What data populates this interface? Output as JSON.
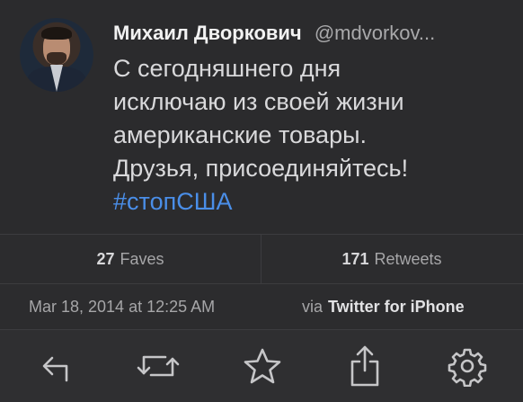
{
  "tweet": {
    "author_name": "Михаил Дворкович",
    "author_handle": "@mdvorkov...",
    "text_lines": [
      "С сегодняшнего дня",
      "исключаю из своей жизни",
      "американские товары.",
      "Друзья, присоединяйтесь!"
    ],
    "hashtag": "#стопСША"
  },
  "stats": {
    "faves_count": "27",
    "faves_label": "Faves",
    "retweets_count": "171",
    "retweets_label": "Retweets"
  },
  "meta": {
    "timestamp": "Mar 18, 2014 at 12:25 AM",
    "via_label": "via",
    "client": "Twitter for iPhone"
  },
  "toolbar": {
    "icons": [
      "reply-icon",
      "retweet-icon",
      "favorite-icon",
      "share-icon",
      "settings-icon"
    ]
  },
  "colors": {
    "background": "#2b2b2d",
    "hashtag": "#4a8ee8",
    "icon": "#c6c6c8"
  }
}
